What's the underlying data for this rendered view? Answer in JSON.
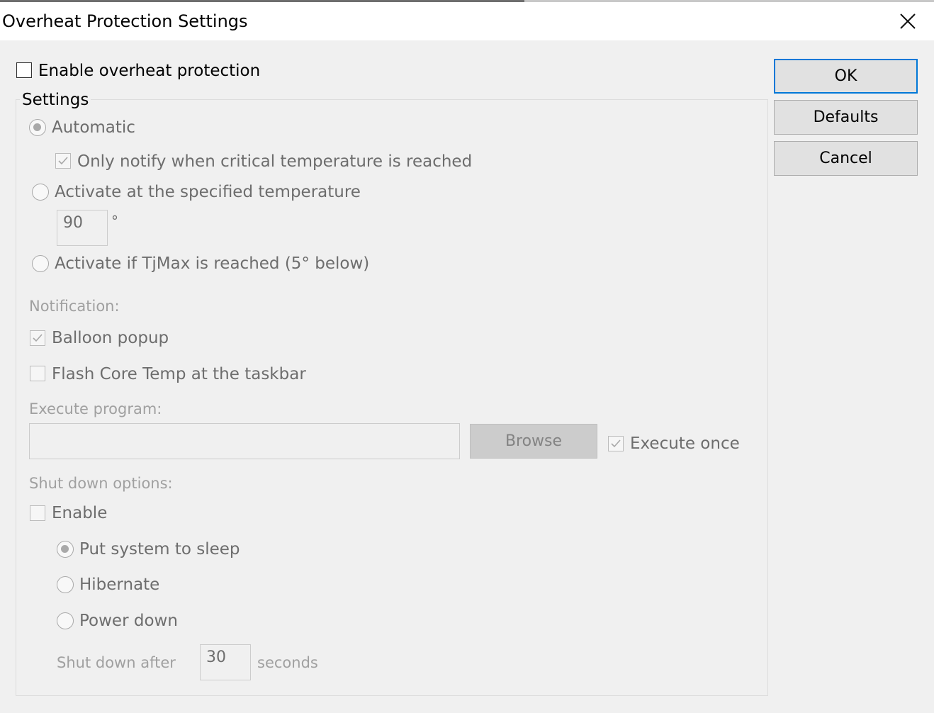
{
  "window": {
    "title": "Overheat Protection Settings"
  },
  "enable_overheat": {
    "label": "Enable overheat protection",
    "checked": false
  },
  "settings_group": {
    "label": "Settings",
    "automatic": {
      "label": "Automatic",
      "selected": true
    },
    "only_notify": {
      "label": "Only notify when critical temperature is reached",
      "checked": true
    },
    "activate_specified": {
      "label": "Activate at the specified temperature",
      "selected": false
    },
    "temperature": {
      "value": "90",
      "unit": "°"
    },
    "activate_tjmax": {
      "label": "Activate if TjMax is reached (5° below)",
      "selected": false
    }
  },
  "notification": {
    "label": "Notification:",
    "balloon": {
      "label": "Balloon popup",
      "checked": true
    },
    "flash": {
      "label": "Flash Core Temp at the taskbar",
      "checked": false
    }
  },
  "execute": {
    "label": "Execute program:",
    "path": "",
    "browse": "Browse",
    "once": {
      "label": "Execute once",
      "checked": true
    }
  },
  "shutdown": {
    "label": "Shut down options:",
    "enable": {
      "label": "Enable",
      "checked": false
    },
    "sleep": {
      "label": "Put system to sleep",
      "selected": true
    },
    "hibernate": {
      "label": "Hibernate",
      "selected": false
    },
    "power_down": {
      "label": "Power down",
      "selected": false
    },
    "after_label": "Shut down after",
    "seconds": "30",
    "seconds_label": "seconds"
  },
  "buttons": {
    "ok": "OK",
    "defaults": "Defaults",
    "cancel": "Cancel"
  },
  "icons": {
    "close": "close-icon",
    "check": "checkmark-icon"
  },
  "colors": {
    "accent": "#0078d7",
    "disabled_text": "#6d6d6d",
    "dialog_bg": "#f0f0f0"
  }
}
